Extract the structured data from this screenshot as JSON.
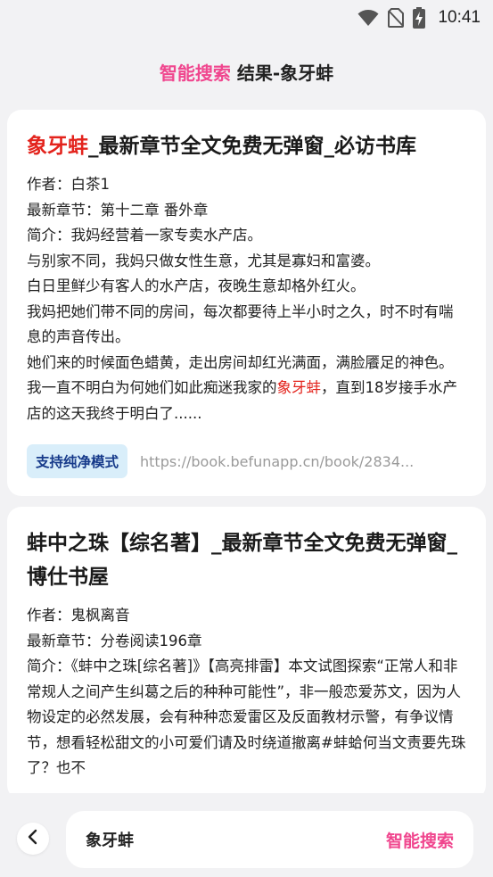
{
  "status_bar": {
    "time": "10:41",
    "icons": [
      "wifi-icon",
      "no-sim-icon",
      "battery-charging-icon"
    ]
  },
  "header": {
    "accent": "智能搜索",
    "rest": " 结果-象牙蚌"
  },
  "results": [
    {
      "title_highlight": "象牙蚌",
      "title_rest": "_最新章节全文免费无弹窗_必访书库",
      "author": "作者：白茶1",
      "latest": "最新章节：第十二章 番外章",
      "summary_before": "简介：我妈经营着一家专卖水产店。\n与别家不同，我妈只做女性生意，尤其是寡妇和富婆。\n白日里鲜少有客人的水产店，夜晚生意却格外红火。\n我妈把她们带不同的房间，每次都要待上半小时之久，时不时有喘息的声音传出。\n她们来的时候面色蜡黄，走出房间却红光满面，满脸餍足的神色。\n我一直不明白为何她们如此痴迷我家的",
      "summary_highlight": "象牙蚌",
      "summary_after": "，直到18岁接手水产店的这天我终于明白了......",
      "badge": "支持纯净模式",
      "url": "https://book.befunapp.cn/book/2834..."
    },
    {
      "title_highlight": "",
      "title_rest": "蚌中之珠【综名著】_最新章节全文免费无弹窗_博仕书屋",
      "author": "作者：鬼枫离音",
      "latest": "最新章节：分卷阅读196章",
      "summary_before": "简介：《蚌中之珠[综名著]》【高亮排雷】本文试图探索“正常人和非常规人之间产生纠葛之后的种种可能性”，非一般恋爱苏文，因为人物设定的必然发展，会有种种恋爱雷区及反面教材示警，有争议情节，想看轻松甜文的小可爱们请及时绕道撤离#蚌蛤何当文责要先珠了？也不",
      "summary_highlight": "",
      "summary_after": ""
    }
  ],
  "bottom_bar": {
    "query": "象牙蚌",
    "search_label": "智能搜索"
  },
  "colors": {
    "accent": "#f0468e",
    "highlight": "#e3231c",
    "badge_bg": "#d9eefa",
    "badge_text": "#163a8a"
  }
}
